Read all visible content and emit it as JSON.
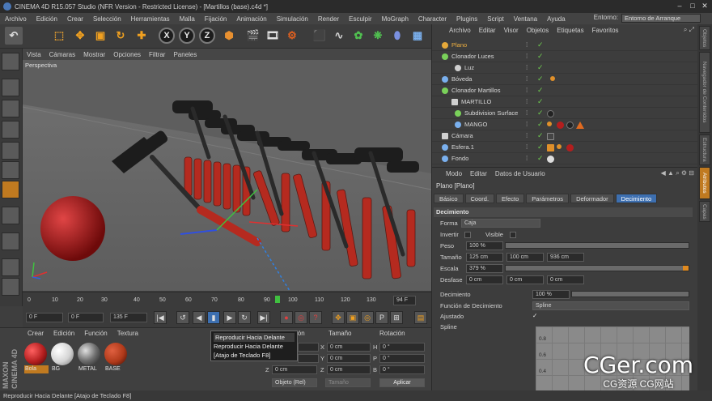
{
  "window": {
    "title": "CINEMA 4D R15.057 Studio (NFR Version - Restricted License) - [Martillos (base).c4d *]"
  },
  "menu": [
    "Archivo",
    "Edición",
    "Crear",
    "Selección",
    "Herramientas",
    "Malla",
    "Fijación",
    "Animación",
    "Simulación",
    "Render",
    "Esculpir",
    "MoGraph",
    "Character",
    "Plugins",
    "Script",
    "Ventana",
    "Ayuda"
  ],
  "entorno": {
    "label": "Entorno:",
    "value": "Entorno de Arranque"
  },
  "toolbar": {
    "x": "X",
    "y": "Y",
    "z": "Z"
  },
  "viewport": {
    "menu": [
      "Vista",
      "Cámaras",
      "Mostrar",
      "Opciones",
      "Filtrar",
      "Paneles"
    ],
    "label": "Perspectiva"
  },
  "timeline": {
    "ticks": [
      "0",
      "10",
      "20",
      "30",
      "40",
      "50",
      "60",
      "70",
      "80",
      "90",
      "100",
      "110",
      "120",
      "130"
    ],
    "end_field": "94 F"
  },
  "playbar": {
    "current": "0 F",
    "start": "0 F",
    "end": "135 F"
  },
  "tooltip": {
    "line1": "Reproducir Hacia Delante",
    "line2": "Reproducir Hacia Delante",
    "line3": "[Atajo de Teclado F8]"
  },
  "material_manager": {
    "menu": [
      "Crear",
      "Edición",
      "Función",
      "Textura"
    ],
    "materials": [
      {
        "name": "Bola",
        "color": "#b31e1e"
      },
      {
        "name": "BG",
        "color": "#d4d4d4"
      },
      {
        "name": "METAL",
        "color": "#6e6e6e"
      },
      {
        "name": "BASE",
        "color": "#b03a1a"
      }
    ]
  },
  "coordinates": {
    "headers": [
      "ión",
      "Tamaño",
      "Rotación"
    ],
    "rows": [
      {
        "size_axis": "X",
        "size": "0 cm",
        "rot_axis": "H",
        "rot": "0 °"
      },
      {
        "size_axis": "Y",
        "size": "0 cm",
        "rot_axis": "P",
        "rot": "0 °"
      },
      {
        "pos_axis": "Z",
        "pos": "0 cm",
        "size_axis": "Z",
        "size": "0 cm",
        "rot_axis": "B",
        "rot": "0 °"
      }
    ],
    "mode": "Objeto (Rel)",
    "size_mode": "Tamaño",
    "apply": "Aplicar"
  },
  "objects": {
    "menu": [
      "Archivo",
      "Editar",
      "Visor",
      "Objetos",
      "Etiquetas",
      "Favoritos"
    ],
    "items": [
      {
        "name": "Plano",
        "color": "#e6a93a",
        "selected": true
      },
      {
        "name": "Clonador Luces",
        "color": "#7ad15a"
      },
      {
        "name": "Luz",
        "color": "#d0d0d0"
      },
      {
        "name": "Bóveda",
        "color": "#7ab0ee"
      },
      {
        "name": "Clonador Martillos",
        "color": "#7ad15a"
      },
      {
        "name": "MARTILLO",
        "color": "#d0d0d0"
      },
      {
        "name": "Subdivision Surface",
        "color": "#7ad15a"
      },
      {
        "name": "MANGO",
        "color": "#7ab0ee"
      },
      {
        "name": "Cámara",
        "color": "#d0d0d0"
      },
      {
        "name": "Esfera.1",
        "color": "#7ab0ee"
      },
      {
        "name": "Fondo",
        "color": "#7ab0ee"
      }
    ]
  },
  "attributes": {
    "menu": [
      "Modo",
      "Editar",
      "Datos de Usuario"
    ],
    "title": "Plano [Plano]",
    "tabs": [
      "Básico",
      "Coord.",
      "Efecto",
      "Parámetros",
      "Deformador",
      "Decimiento"
    ],
    "section": "Decimiento",
    "forma_label": "Forma",
    "forma_value": "Caja",
    "invertir_label": "Invertir",
    "visible_label": "Visible",
    "peso_label": "Peso",
    "peso_value": "100 %",
    "tamano_label": "Tamaño",
    "tamano_x": "125 cm",
    "tamano_y": "100 cm",
    "tamano_z": "936 cm",
    "escala_label": "Escala",
    "escala_value": "379 %",
    "desfase_label": "Desfase",
    "desfase_x": "0 cm",
    "desfase_y": "0 cm",
    "desfase_z": "0 cm",
    "decimiento_label": "Decimiento",
    "decimiento_value": "100 %",
    "funcion_label": "Función de Decimiento",
    "funcion_value": "Spline",
    "ajustado_label": "Ajustado",
    "ajustado_check": "✓",
    "spline_label": "Spline",
    "graph_labels": [
      "0.8",
      "0.6",
      "0.4"
    ]
  },
  "right_tabs": [
    "Objetos",
    "Navegador de Contenidos",
    "Estructura",
    "Atributos",
    "Capas"
  ],
  "status": "Reproducir Hacia Delante [Atajo de Teclado F8]",
  "maxon": "MAXON CINEMA 4D",
  "watermark": {
    "big": "CGer.com",
    "small": "CG资源 CG网站"
  }
}
